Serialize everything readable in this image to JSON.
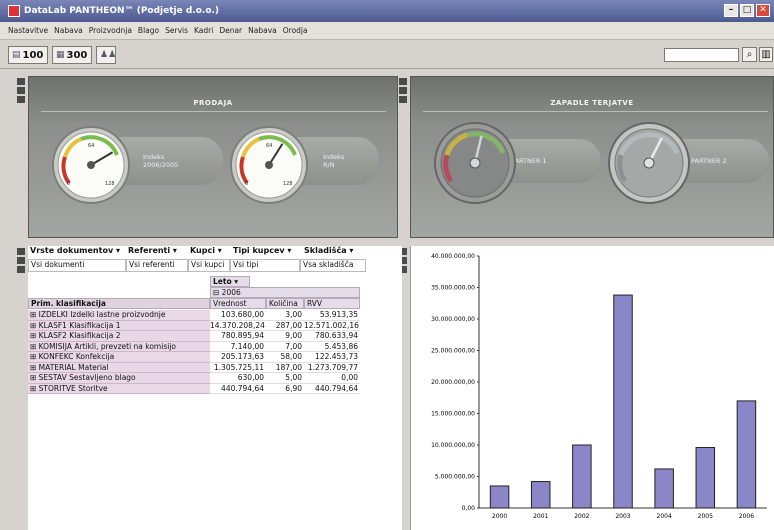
{
  "window": {
    "title": "DataLab PANTHEON™ (Podjetje d.o.o.)",
    "minimize": "–",
    "maximize": "□",
    "close": "✕"
  },
  "menu": [
    "Nastavitve",
    "Nabava",
    "Proizvodnja",
    "Blago",
    "Servis",
    "Kadri",
    "Denar",
    "Nabava",
    "Orodja"
  ],
  "toolbar": {
    "btn1_label": "100",
    "btn2_label": "300",
    "btn3_label": "",
    "search_placeholder": "",
    "zoom_icon": "magnifier-icon"
  },
  "dashboard": {
    "left_title": "PRODAJA",
    "right_title": "ZAPADLE TERJATVE",
    "gauges_left": [
      {
        "label_line1": "Indeks",
        "label_line2": "2006/2005",
        "min": "0",
        "mid": "64",
        "max": "128",
        "level": 0.72
      },
      {
        "label_line1": "Indeks",
        "label_line2": "R/N",
        "min": "0",
        "mid": "64",
        "max": "128",
        "level": 0.62
      }
    ],
    "gauges_right": [
      {
        "label": "PARTNER 1",
        "level": 0.55
      },
      {
        "label": "PARTNER 2",
        "level": 0.6
      }
    ]
  },
  "pivot": {
    "filters": [
      {
        "header": "Vrste dokumentov ▾",
        "value": "Vsi dokumenti"
      },
      {
        "header": "Referenti ▾",
        "value": "Vsi referenti"
      },
      {
        "header": "Kupci ▾",
        "value": "Vsi kupci"
      },
      {
        "header": "Tipi kupcev ▾",
        "value": "Vsi tipi"
      },
      {
        "header": "Skladišča ▾",
        "value": "Vsa skladišča"
      }
    ],
    "year_field": "Leto ▾",
    "year_value": "⊟ 2006",
    "row_field": "Prim. klasifikacija",
    "columns": [
      "Vrednost",
      "Količina",
      "RVV"
    ],
    "rows": [
      {
        "label": "⊞ IZDELKI  Izdelki lastne proizvodnje",
        "vrednost": "103.680,00",
        "kolicina": "3,00",
        "rvv": "53.913,35"
      },
      {
        "label": "⊞ KLASF1  Klasifikacija 1",
        "vrednost": "14.370.208,24",
        "kolicina": "287,00",
        "rvv": "12.571.002,16"
      },
      {
        "label": "⊞ KLASF2  Klasifikacija 2",
        "vrednost": "780.895,94",
        "kolicina": "9,00",
        "rvv": "780.633,94"
      },
      {
        "label": "⊞ KOMISIJA  Artikli, prevzeti na komisijo",
        "vrednost": "7.140,00",
        "kolicina": "7,00",
        "rvv": "5.453,86"
      },
      {
        "label": "⊞ KONFEKC  Konfekcija",
        "vrednost": "205.173,63",
        "kolicina": "58,00",
        "rvv": "122.453,73"
      },
      {
        "label": "⊞ MATERIAL  Material",
        "vrednost": "1.305.725,11",
        "kolicina": "187,00",
        "rvv": "1.273.709,77"
      },
      {
        "label": "⊞ SESTAV  Sestavljeno blago",
        "vrednost": "630,00",
        "kolicina": "5,00",
        "rvv": "0,00"
      },
      {
        "label": "⊞ STORITVE  Storitve",
        "vrednost": "440.794,64",
        "kolicina": "6,90",
        "rvv": "440.794,64"
      }
    ]
  },
  "chart_data": {
    "type": "bar",
    "categories": [
      "2000",
      "2001",
      "2002",
      "2003",
      "2004",
      "2005",
      "2006"
    ],
    "values": [
      3500000,
      4200000,
      10000000,
      33800000,
      6200000,
      9600000,
      17000000
    ],
    "ylim": [
      0,
      40000000
    ],
    "yticks": [
      "0,00",
      "5.000.000,00",
      "10.000.000,00",
      "15.000.000,00",
      "20.000.000,00",
      "25.000.000,00",
      "30.000.000,00",
      "35.000.000,00",
      "40.000.000,00"
    ],
    "title": "",
    "xlabel": "",
    "ylabel": "",
    "bar_color": "#8a86c7",
    "grid": false
  }
}
